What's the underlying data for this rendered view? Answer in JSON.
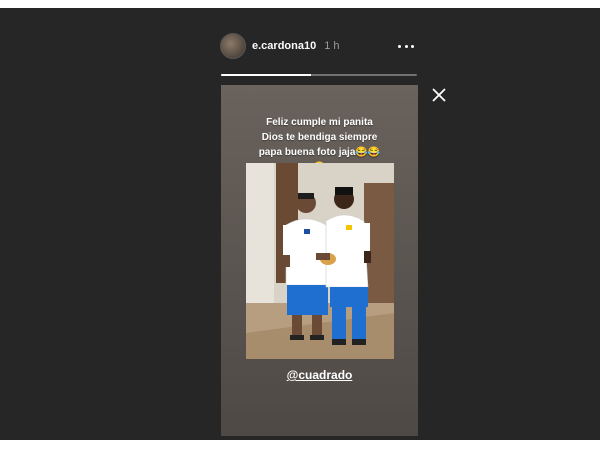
{
  "story": {
    "username": "e.cardona10",
    "time": "1 h",
    "progress": 0.46,
    "caption": [
      "Feliz cumple mi panita",
      "Dios te bendiga siempre",
      "papa  buena foto jaja😂😂",
      "😂"
    ],
    "mention": "@cuadrado"
  },
  "icons": {
    "more": "more-options-icon",
    "close": "close-icon",
    "avatar": "profile-avatar"
  },
  "colors": {
    "viewer_background": "#262626",
    "shirt": "#ffffff",
    "shorts": "#1e6fd0"
  }
}
